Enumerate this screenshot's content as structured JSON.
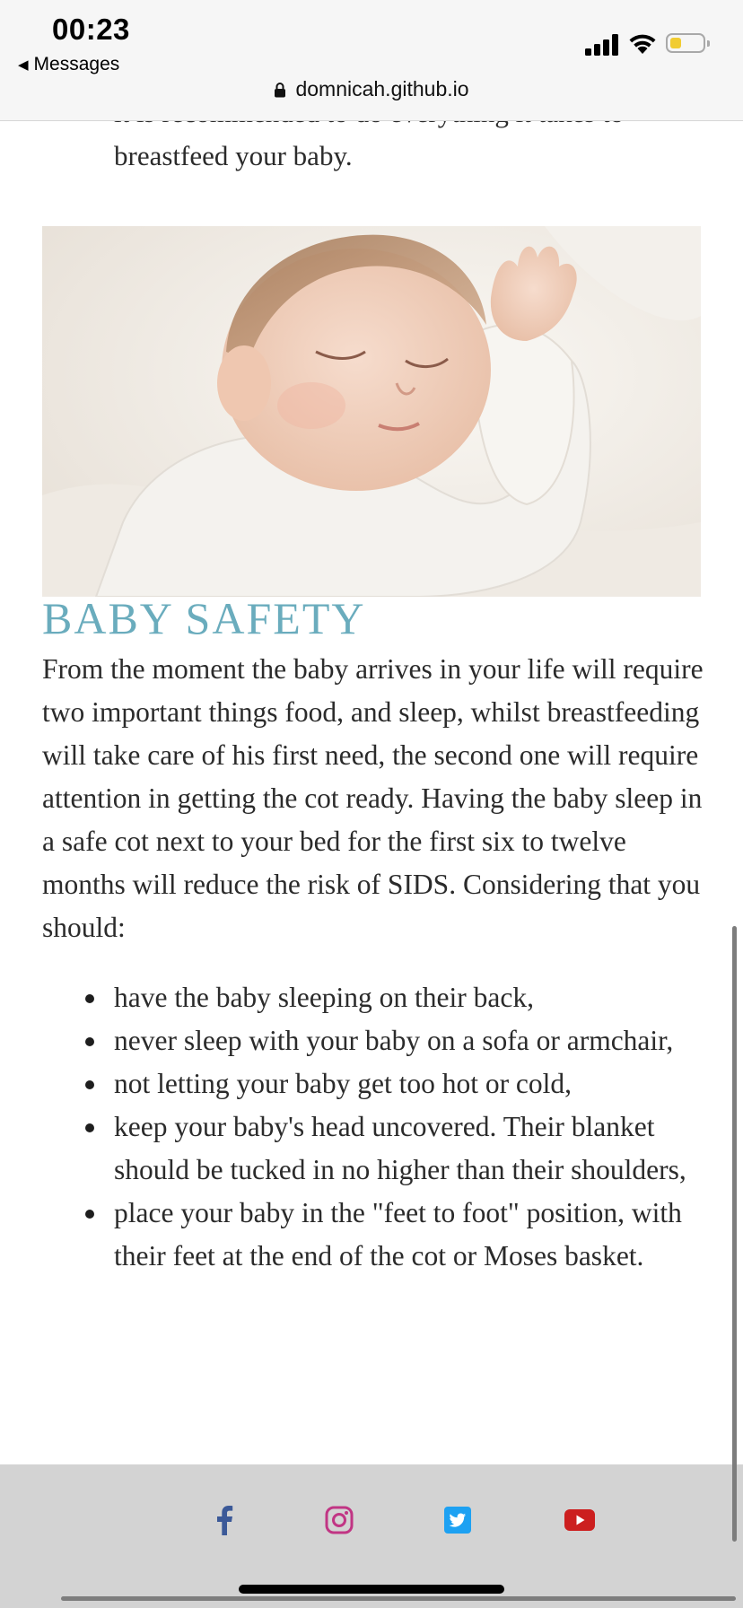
{
  "status_bar": {
    "time": "00:23",
    "back_label": "Messages"
  },
  "browser": {
    "url": "domnicah.github.io"
  },
  "article": {
    "prev_paragraph_cut": "it is recommended to do everything it takes to",
    "prev_paragraph_end": "breastfeed your baby.",
    "image_subject": "sleeping-baby-photo",
    "section_title": "BABY SAFETY",
    "intro": "From the moment the baby arrives in your life will require two important things food, and sleep, whilst breastfeeding will take care of his first need, the second one will require attention in getting the cot ready. Having the baby sleep in a safe cot next to your bed for the first six to twelve months will reduce the risk of SIDS. Considering that you should:",
    "tips": [
      "have the baby sleeping on their back,",
      "never sleep with your baby on a sofa or armchair,",
      "not letting your baby get too hot or cold,",
      "keep your baby's head uncovered. Their blanket should be tucked in no higher than their shoulders,",
      "place your baby in the \"feet to foot\" position, with their feet at the end of the cot or Moses basket."
    ]
  },
  "footer": {
    "social": [
      {
        "name": "facebook-icon",
        "color": "#3b5998"
      },
      {
        "name": "instagram-icon",
        "color": "#c13584"
      },
      {
        "name": "twitter-icon",
        "color": "#1da1f2"
      },
      {
        "name": "youtube-icon",
        "color": "#cc1f1f"
      }
    ]
  },
  "colors": {
    "title_accent": "#6aacbd",
    "footer_bg": "#d3d3d3",
    "battery_fill": "#f1cc32"
  }
}
